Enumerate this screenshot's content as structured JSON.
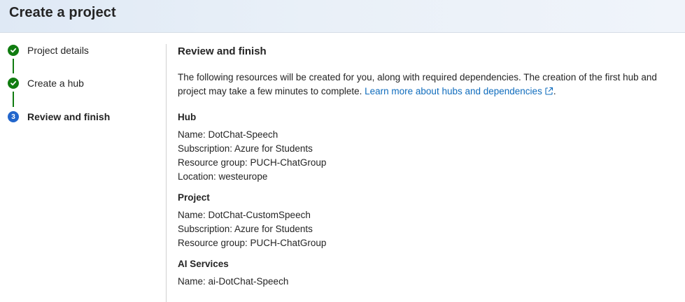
{
  "header": {
    "title": "Create a project"
  },
  "steps": [
    {
      "label": "Project details",
      "status": "complete"
    },
    {
      "label": "Create a hub",
      "status": "complete"
    },
    {
      "label": "Review and finish",
      "status": "current",
      "number": "3"
    }
  ],
  "content": {
    "title": "Review and finish",
    "intro_text": "The following resources will be created for you, along with required dependencies. The creation of the first hub and project may take a few minutes to complete. ",
    "intro_link": "Learn more about hubs and dependencies",
    "intro_trailing": ".",
    "hub": {
      "title": "Hub",
      "name": "Name: DotChat-Speech",
      "subscription": "Subscription: Azure for Students",
      "resource_group": "Resource group: PUCH-ChatGroup",
      "location": "Location: westeurope"
    },
    "project": {
      "title": "Project",
      "name": "Name: DotChat-CustomSpeech",
      "subscription": "Subscription: Azure for Students",
      "resource_group": "Resource group: PUCH-ChatGroup"
    },
    "ai_services": {
      "title": "AI Services",
      "name": "Name: ai-DotChat-Speech"
    }
  },
  "colors": {
    "complete": "#107c10",
    "current": "#2266cc",
    "link": "#0f6cbd"
  },
  "icons": {
    "complete": "checkmark-circle-icon",
    "external": "open-external-icon"
  }
}
